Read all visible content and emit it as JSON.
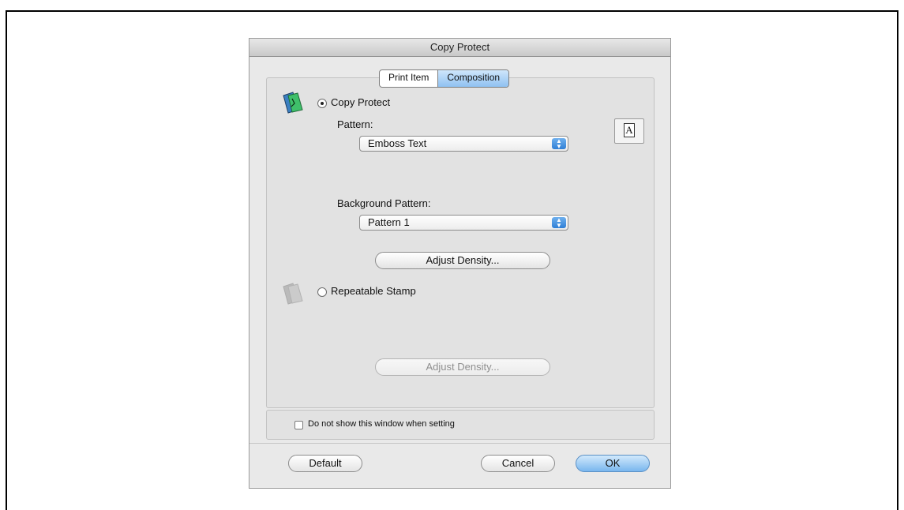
{
  "dialog": {
    "title": "Copy Protect",
    "tabs": [
      {
        "label": "Print Item",
        "active": false
      },
      {
        "label": "Composition",
        "active": true
      }
    ],
    "copy_protect": {
      "label": "Copy Protect",
      "selected": true,
      "pattern_label": "Pattern:",
      "pattern_value": "Emboss Text",
      "background_pattern_label": "Background Pattern:",
      "background_pattern_value": "Pattern 1",
      "adjust_density_label": "Adjust Density..."
    },
    "repeatable_stamp": {
      "label": "Repeatable Stamp",
      "selected": false,
      "adjust_density_label": "Adjust Density..."
    },
    "preview_glyph": "A",
    "dont_show_label": "Do not show this window when setting",
    "dont_show_checked": false,
    "buttons": {
      "default": "Default",
      "cancel": "Cancel",
      "ok": "OK"
    }
  },
  "colors": {
    "dialog_bg": "#e9e9e9",
    "accent_blue": "#79b6ee",
    "disabled_text": "#8f8f8f"
  },
  "icons": [
    "copy-protect-book-icon",
    "repeatable-stamp-book-icon",
    "popup-arrows-icon",
    "preview-page-icon"
  ]
}
